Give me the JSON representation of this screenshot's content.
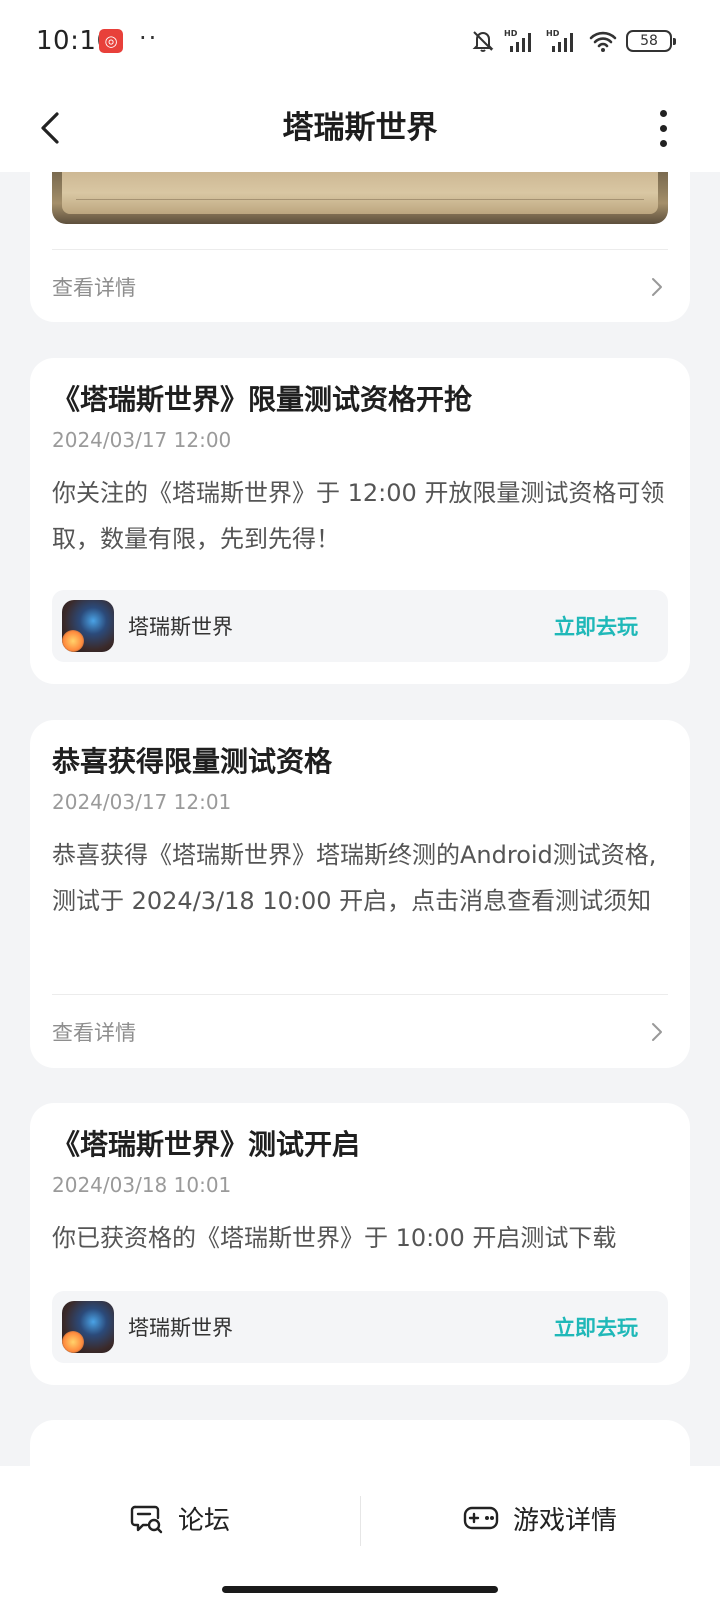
{
  "status": {
    "time": "10:16",
    "app_badge": "◎",
    "dots": "··",
    "battery": "58",
    "hd_label": "HD"
  },
  "nav": {
    "title": "塔瑞斯世界"
  },
  "card0": {
    "detail_label": "查看详情"
  },
  "card1": {
    "title": "《塔瑞斯世界》限量测试资格开抢",
    "time": "2024/03/17 12:00",
    "body": "你关注的《塔瑞斯世界》于 12:00 开放限量测试资格可领取，数量有限，先到先得！",
    "game_name": "塔瑞斯世界",
    "play_label": "立即去玩"
  },
  "card2": {
    "title": "恭喜获得限量测试资格",
    "time": "2024/03/17 12:01",
    "body": "恭喜获得《塔瑞斯世界》塔瑞斯终测的Android测试资格,测试于 2024/3/18 10:00 开启，点击消息查看测试须知",
    "detail_label": "查看详情"
  },
  "card3": {
    "title": "《塔瑞斯世界》测试开启",
    "time": "2024/03/18 10:01",
    "body": "你已获资格的《塔瑞斯世界》于 10:00 开启测试下载",
    "game_name": "塔瑞斯世界",
    "play_label": "立即去玩"
  },
  "bottom": {
    "forum_label": "论坛",
    "game_detail_label": "游戏详情"
  },
  "colors": {
    "accent": "#1fb8b8",
    "background": "#f3f4f6"
  }
}
